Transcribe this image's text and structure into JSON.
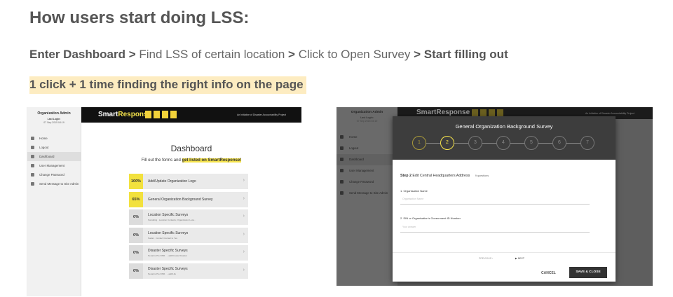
{
  "heading": "How users start doing LSS:",
  "flow": {
    "step1": "Enter Dashboard",
    "step2": "Find LSS of certain location",
    "step3": "Click to Open Survey",
    "step4": "Start filling out",
    "separator": ">"
  },
  "click_summary": "1 click + 1 time finding the right info on the page",
  "left_screenshot": {
    "sidebar": {
      "org": "Organization Admin",
      "last_login_label": "Last Login:",
      "last_login_date": "07 Sep 2015 04:19",
      "items": [
        {
          "label": "Home",
          "icon": "home-icon"
        },
        {
          "label": "Logout",
          "icon": "lock-icon"
        },
        {
          "label": "Dashboard",
          "icon": "dashboard-icon",
          "active": true
        },
        {
          "label": "User Management",
          "icon": "users-icon"
        },
        {
          "label": "Change Password",
          "icon": "user-icon"
        },
        {
          "label": "Send Message to Site Admin",
          "icon": "message-icon"
        }
      ]
    },
    "topbar": {
      "logo_a": "Smart",
      "logo_b": "Response",
      "tagline": "An Initiative of Disaster Accountability Project"
    },
    "title": "Dashboard",
    "subtitle": "Fill out the forms and ",
    "subtitle_highlight": "get listed on SmartResponse!",
    "rows": [
      {
        "pct": "100%",
        "name": "Add/Update Organization Logo",
        "meta": "",
        "highlight": true
      },
      {
        "pct": "65%",
        "name": "General Organization Background Survey",
        "meta": "",
        "highlight": true
      },
      {
        "pct": "0%",
        "name": "Location Specific Surveys",
        "meta": "Somalling · Location Contacts, Organization Loca..",
        "highlight": false
      },
      {
        "pct": "0%",
        "name": "Location Specific Surveys",
        "meta": "Sudan · Contact Contact to Yes",
        "highlight": false
      },
      {
        "pct": "0%",
        "name": "Disaster Specific Surveys",
        "meta": "Nenazre Pre DNR · ...add/Create Disaster",
        "highlight": false
      },
      {
        "pct": "0%",
        "name": "Disaster Specific Surveys",
        "meta": "Nenazre Pre DNR · ...add/Life",
        "highlight": false
      }
    ]
  },
  "right_screenshot": {
    "sidebar": {
      "org": "Organization Admin",
      "last_login_label": "Last Login:",
      "last_login_date": "07 Sep 2015 04:19",
      "items": [
        {
          "label": "Home",
          "icon": "home-icon"
        },
        {
          "label": "Logout",
          "icon": "lock-icon"
        },
        {
          "label": "Dashboard",
          "icon": "dashboard-icon",
          "active": true
        },
        {
          "label": "User Management",
          "icon": "users-icon"
        },
        {
          "label": "Change Password",
          "icon": "user-icon"
        },
        {
          "label": "Send Message to Site Admin",
          "icon": "message-icon"
        }
      ]
    },
    "topbar": {
      "logo": "SmartResponse",
      "tagline": "An Initiative of Disaster Accountability Project"
    },
    "modal": {
      "title": "General Organization Background Survey",
      "steps": [
        "1",
        "2",
        "3",
        "4",
        "5",
        "6",
        "7"
      ],
      "current_step": 2,
      "step_label": "Step 2",
      "step_title": "Edit Central Headquarters Address",
      "question_count": "9 questions",
      "field1_label": "1. Organisation Name",
      "field1_placeholder": "Organisation Name",
      "field2_label": "2. EIN or Organisation's Government ID Number",
      "field2_placeholder": "Your answer",
      "prev_label": "PREVIOUS",
      "next_label": "NEXT",
      "cancel_label": "CANCEL",
      "save_label": "SAVE & CLOSE"
    }
  }
}
